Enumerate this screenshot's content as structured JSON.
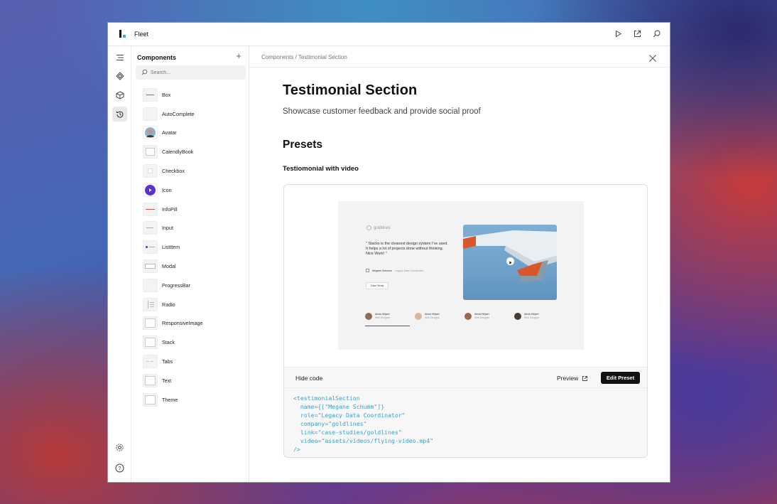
{
  "app": {
    "title": "Fleet"
  },
  "sidebar": {
    "title": "Components",
    "add_label": "+",
    "search_placeholder": "Search...",
    "items": [
      {
        "label": "Box"
      },
      {
        "label": "AutoComplete"
      },
      {
        "label": "Avatar"
      },
      {
        "label": "CalendlyBook"
      },
      {
        "label": "Checkbox"
      },
      {
        "label": "Icon"
      },
      {
        "label": "InfoPill"
      },
      {
        "label": "Input"
      },
      {
        "label": "ListItem"
      },
      {
        "label": "Modal"
      },
      {
        "label": "ProgressBar"
      },
      {
        "label": "Radio"
      },
      {
        "label": "ResponsiveImage"
      },
      {
        "label": "Stack"
      },
      {
        "label": "Tabs"
      },
      {
        "label": "Text"
      },
      {
        "label": "Theme"
      }
    ]
  },
  "main": {
    "breadcrumb": "Components / Testimonial Section",
    "title": "Testimonial Section",
    "subtitle": "Showcase customer feedback and provide social proof",
    "section_title": "Presets",
    "preset_title": "Testiomonial with video",
    "preview": {
      "brand": "goldlines",
      "quote": "\" Stacks is the cleanest design system I've used. It helps a lot of projects done without thinking. Nice Work! \"",
      "author": "Megane Schumm",
      "role": "Legacy Data Coordinator",
      "button": "Case Study",
      "tabs": [
        {
          "name": "Alexis Hillpert",
          "role": "Web Designer"
        },
        {
          "name": "Alexis Hillpert",
          "role": "Web Designer"
        },
        {
          "name": "Alexis Hillpert",
          "role": "Web Designer"
        },
        {
          "name": "Alexis Hillpert",
          "role": "Web Designer"
        }
      ]
    },
    "toolbar": {
      "hide_code": "Hide code",
      "preview": "Preview",
      "edit_preset": "Edit Preset"
    },
    "code": "<testimonialSection\n  name={[\"Megane Schumm\"]}\n  role=\"Legacy Data Coordinator\"\n  company=\"goldlines\"\n  link=\"case-studies/goldlines\"\n  video=\"assets/videos/flying-video.mp4\"\n/>"
  },
  "colors": {
    "code": "#3aa2c9",
    "icon_badge": "#5a2fd6",
    "accent": "#2ab0ff"
  }
}
